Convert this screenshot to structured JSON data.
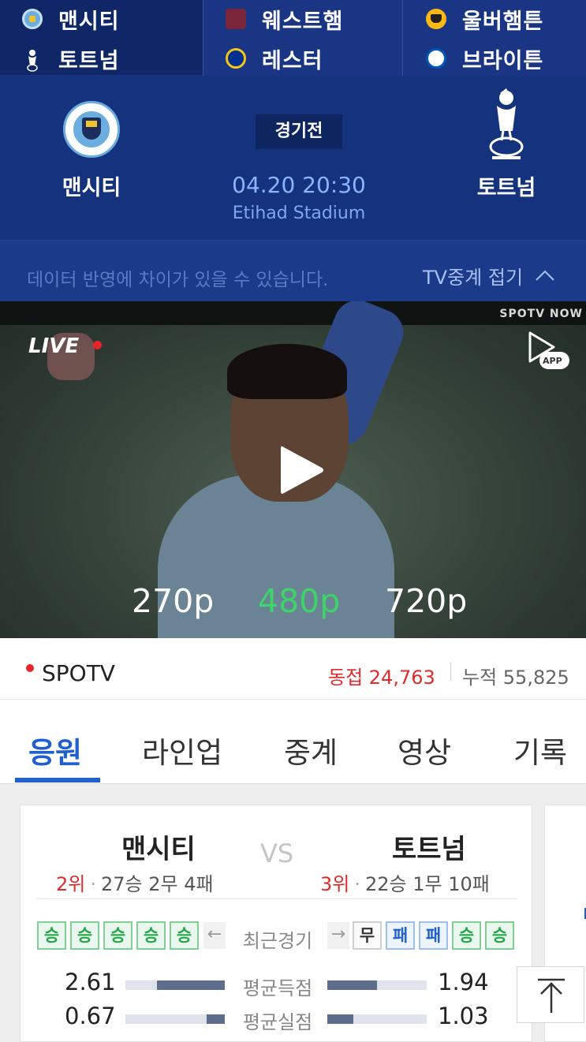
{
  "strip": {
    "matches": [
      {
        "home": "맨시티",
        "away": "토트넘",
        "home_logo": "man-city-crest",
        "away_logo": "tottenham-crest"
      },
      {
        "home": "웨스트햄",
        "away": "레스터",
        "home_logo": "west-ham-crest",
        "away_logo": "leicester-crest"
      },
      {
        "home": "울버햄튼",
        "away": "브라이튼",
        "home_logo": "wolves-crest",
        "away_logo": "brighton-crest"
      }
    ]
  },
  "match": {
    "home_team": "맨시티",
    "away_team": "토트넘",
    "status": "경기전",
    "datetime": "04.20 20:30",
    "venue": "Etihad Stadium"
  },
  "notice": {
    "text": "데이터 반영에 차이가 있을 수 있습니다.",
    "tv_toggle_label": "TV중계 접기"
  },
  "video": {
    "brand": "SPOTV NOW",
    "live_label": "LIVE",
    "app_label": "APP",
    "qualities": [
      "270p",
      "480p",
      "720p"
    ],
    "selected_quality": "480p"
  },
  "broadcast": {
    "channel": "SPOTV",
    "concurrent": "동접 24,763",
    "cumulative": "누적 55,825"
  },
  "tabs": [
    "응원",
    "라인업",
    "중계",
    "영상",
    "기록"
  ],
  "active_tab": "응원",
  "card": {
    "home": {
      "name": "맨시티",
      "rank": "2위",
      "record": "27승 2무 4패",
      "recent_form": [
        "승",
        "승",
        "승",
        "승",
        "승"
      ]
    },
    "away": {
      "name": "토트넘",
      "rank": "3위",
      "record": "22승 1무 10패",
      "recent_form": [
        "무",
        "패",
        "패",
        "승",
        "승"
      ]
    },
    "vs": "VS",
    "recent_label": "최근경기",
    "stats": [
      {
        "label": "평균득점",
        "home": "2.61",
        "away": "1.94",
        "home_fill": 0.68,
        "away_fill": 0.5
      },
      {
        "label": "평균실점",
        "home": "0.67",
        "away": "1.03",
        "home_fill": 0.18,
        "away_fill": 0.26
      }
    ]
  },
  "colors": {
    "navy": "#14337c",
    "accent_blue": "#1f5fcf",
    "live_red": "#e8232a",
    "quality_selected": "#3ed36b",
    "win_green": "#23a74a"
  }
}
